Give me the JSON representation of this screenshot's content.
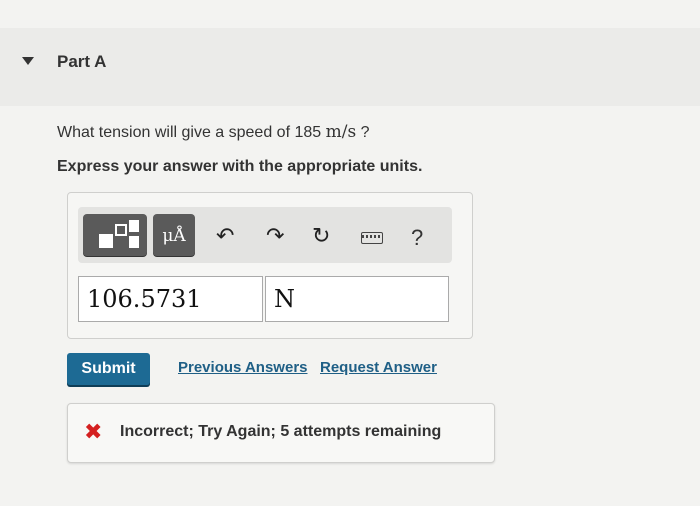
{
  "part": {
    "title": "Part A"
  },
  "question": {
    "text_before": "What tension will give a speed of 185 ",
    "unit_math": "m/s",
    "text_after": " ?",
    "instruction": "Express your answer with the appropriate units."
  },
  "toolbar": {
    "templates_icon": "templates-icon",
    "units_label": "μÅ",
    "undo_icon": "undo-icon",
    "redo_icon": "redo-icon",
    "reset_icon": "reset-icon",
    "keyboard_icon": "keyboard-icon",
    "help_label": "?"
  },
  "answer": {
    "value": "106.5731",
    "unit": "N"
  },
  "actions": {
    "submit_label": "Submit",
    "previous_answers_label": "Previous Answers",
    "request_answer_label": "Request Answer"
  },
  "feedback": {
    "icon": "x-icon",
    "icon_color": "#d42020",
    "message": "Incorrect; Try Again; 5 attempts remaining"
  },
  "colors": {
    "submit_bg": "#1d6a94",
    "link": "#1f5f86"
  }
}
